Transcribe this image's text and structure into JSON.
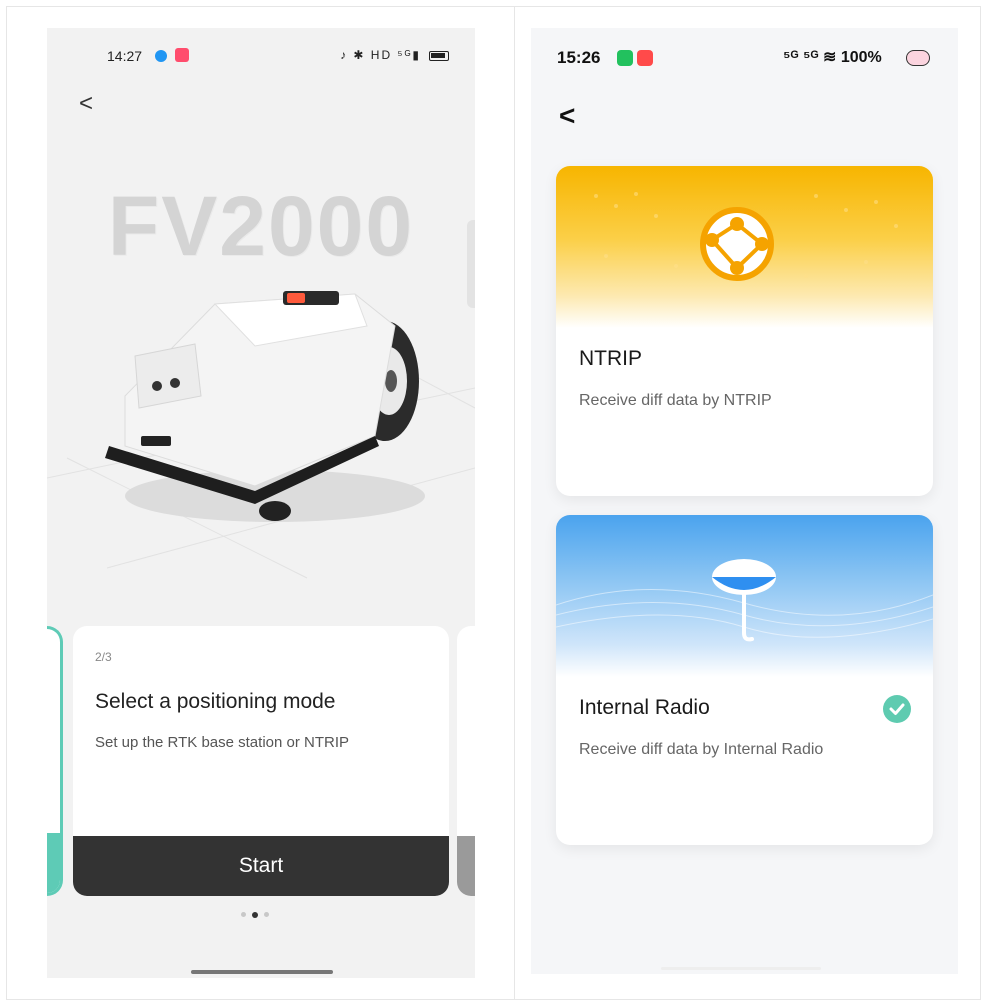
{
  "left_screen": {
    "status_bar": {
      "time": "14:27",
      "system_icons": "♪ ✱ HD ⁵ᴳ▮"
    },
    "back_label": "<",
    "model_name": "FV2000",
    "card": {
      "step": "2/3",
      "title": "Select a positioning mode",
      "description": "Set up the RTK base station or NTRIP",
      "button_label": "Start"
    },
    "pagination": {
      "total": 3,
      "active": 2
    }
  },
  "right_screen": {
    "status_bar": {
      "time": "15:26",
      "system_icons": "⁵ᴳ ⁵ᴳ ≋ 100%"
    },
    "back_label": "<",
    "modes": [
      {
        "name": "NTRIP",
        "description": "Receive diff data by NTRIP",
        "selected": false
      },
      {
        "name": "Internal Radio",
        "description": "Receive diff data by Internal Radio",
        "selected": true
      }
    ]
  },
  "colors": {
    "accent_teal": "#5ecbb0",
    "button_dark": "#333333",
    "ntrip_banner": "#f7b500",
    "radio_banner": "#4aa3ee"
  }
}
